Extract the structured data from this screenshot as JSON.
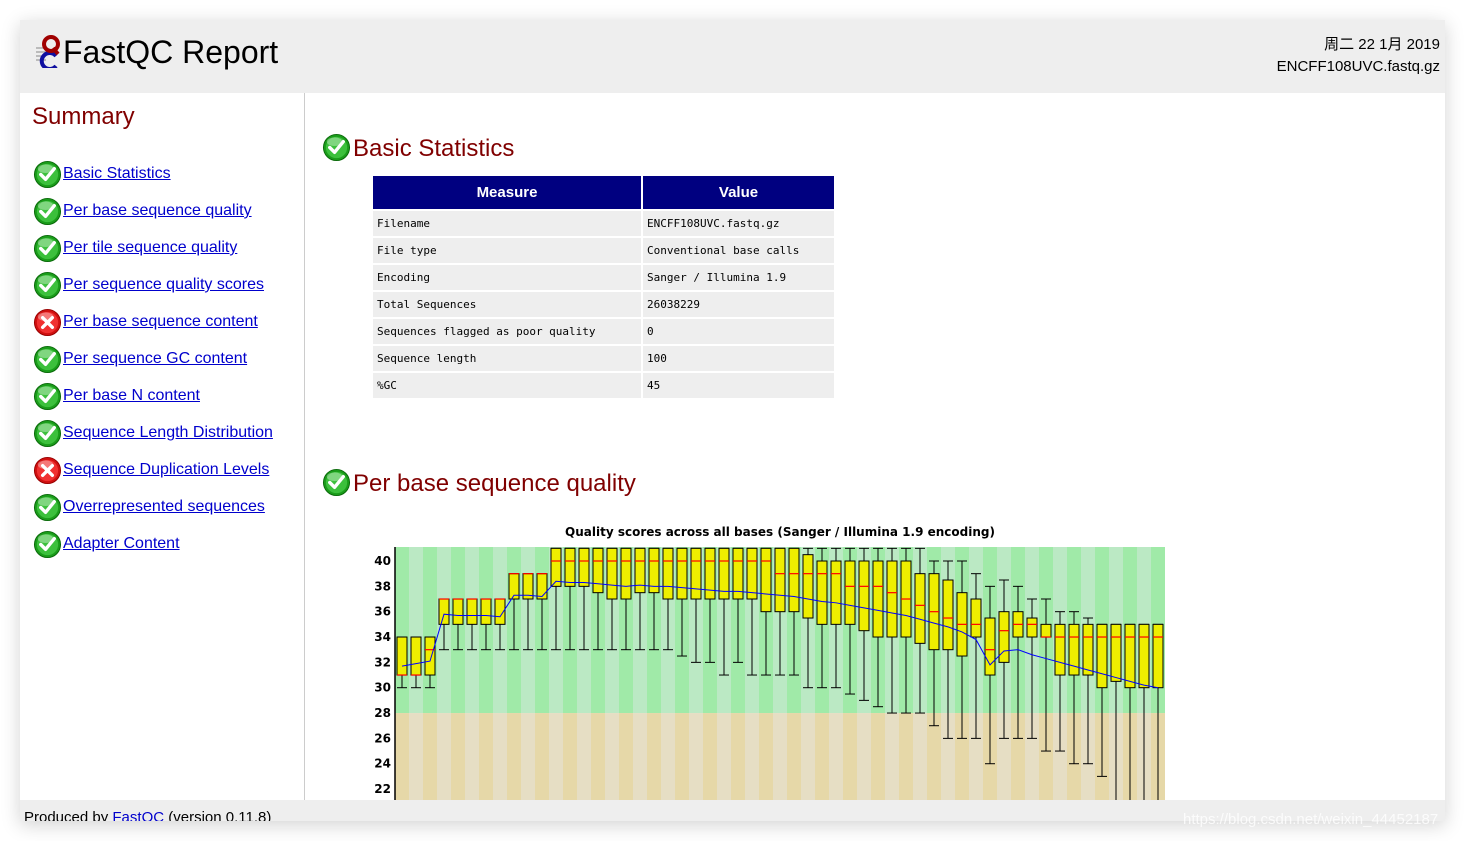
{
  "header": {
    "title": "FastQC Report",
    "date": "周二 22 1月 2019",
    "filename": "ENCFF108UVC.fastq.gz"
  },
  "sidebar": {
    "title": "Summary",
    "items": [
      {
        "label": "Basic Statistics",
        "status": "pass"
      },
      {
        "label": "Per base sequence quality",
        "status": "pass"
      },
      {
        "label": "Per tile sequence quality",
        "status": "pass"
      },
      {
        "label": "Per sequence quality scores",
        "status": "pass"
      },
      {
        "label": "Per base sequence content",
        "status": "fail"
      },
      {
        "label": "Per sequence GC content",
        "status": "pass"
      },
      {
        "label": "Per base N content",
        "status": "pass"
      },
      {
        "label": "Sequence Length Distribution",
        "status": "pass"
      },
      {
        "label": "Sequence Duplication Levels",
        "status": "fail"
      },
      {
        "label": "Overrepresented sequences",
        "status": "pass"
      },
      {
        "label": "Adapter Content",
        "status": "pass"
      }
    ]
  },
  "basic_stats": {
    "title": "Basic Statistics",
    "status": "pass",
    "headers": [
      "Measure",
      "Value"
    ],
    "rows": [
      [
        "Filename",
        "ENCFF108UVC.fastq.gz"
      ],
      [
        "File type",
        "Conventional base calls"
      ],
      [
        "Encoding",
        "Sanger / Illumina 1.9"
      ],
      [
        "Total Sequences",
        "26038229"
      ],
      [
        "Sequences flagged as poor quality",
        "0"
      ],
      [
        "Sequence length",
        "100"
      ],
      [
        "%GC",
        "45"
      ]
    ]
  },
  "per_base_quality": {
    "title": "Per base sequence quality",
    "status": "pass"
  },
  "chart_data": {
    "type": "boxplot",
    "title": "Quality scores across all bases (Sanger / Illumina 1.9 encoding)",
    "xlabel": "",
    "ylabel": "",
    "ylim": [
      21,
      41
    ],
    "yticks": [
      "22",
      "24",
      "26",
      "28",
      "30",
      "32",
      "34",
      "36",
      "38",
      "40"
    ],
    "zones": [
      {
        "from": 28,
        "to": 41,
        "color": "#a0eaa8"
      },
      {
        "from": 0,
        "to": 28,
        "color": "#e6d8a8"
      }
    ],
    "columns": [
      "low",
      "q1",
      "median",
      "q3",
      "high",
      "mean"
    ],
    "boxes": [
      [
        30,
        31,
        31,
        34,
        34,
        31.7
      ],
      [
        30,
        31,
        31,
        34,
        34,
        31.9
      ],
      [
        30,
        31,
        33,
        34,
        34,
        32.1
      ],
      [
        33,
        35,
        37,
        37,
        37,
        35.8
      ],
      [
        33,
        35,
        37,
        37,
        37,
        35.7
      ],
      [
        33,
        35,
        37,
        37,
        37,
        35.7
      ],
      [
        33,
        35,
        37,
        37,
        37,
        35.7
      ],
      [
        33,
        35,
        37,
        37,
        37,
        35.6
      ],
      [
        33,
        37,
        39,
        39,
        39,
        37.3
      ],
      [
        33,
        37,
        39,
        39,
        39,
        37.3
      ],
      [
        33,
        37,
        39,
        39,
        39,
        37.2
      ],
      [
        33,
        38,
        40,
        41,
        41,
        38.4
      ],
      [
        33,
        38,
        40,
        41,
        41,
        38.3
      ],
      [
        33,
        38,
        40,
        41,
        41,
        38.3
      ],
      [
        33,
        37.5,
        40,
        41,
        41,
        38.2
      ],
      [
        33,
        37,
        40,
        41,
        41,
        38.1
      ],
      [
        33,
        37,
        40,
        41,
        41,
        38.0
      ],
      [
        33,
        37.5,
        40,
        41,
        41,
        38.1
      ],
      [
        33,
        37.5,
        40,
        41,
        41,
        38.0
      ],
      [
        33,
        37,
        40,
        41,
        41,
        38.0
      ],
      [
        32.5,
        37,
        40,
        41,
        41,
        37.9
      ],
      [
        32,
        37,
        40,
        41,
        41,
        37.8
      ],
      [
        32,
        37,
        40,
        41,
        41,
        37.7
      ],
      [
        31,
        37,
        40,
        41,
        41,
        37.6
      ],
      [
        32,
        37,
        40,
        41,
        41,
        37.6
      ],
      [
        31,
        37,
        40,
        41,
        41,
        37.5
      ],
      [
        31,
        36,
        40,
        41,
        41,
        37.4
      ],
      [
        31,
        36,
        39,
        41,
        41,
        37.3
      ],
      [
        31,
        36,
        39,
        41,
        41,
        37.2
      ],
      [
        30,
        35.5,
        39,
        40.5,
        41,
        37.0
      ],
      [
        30,
        35,
        39,
        40,
        41,
        36.8
      ],
      [
        30,
        35,
        39,
        40,
        41,
        36.7
      ],
      [
        29.5,
        35,
        38,
        40,
        41,
        36.5
      ],
      [
        29,
        34.5,
        38,
        40,
        41,
        36.3
      ],
      [
        28.5,
        34,
        38,
        40,
        41,
        36.1
      ],
      [
        28,
        34,
        37.5,
        40,
        41,
        35.9
      ],
      [
        28,
        34,
        37,
        40,
        41,
        35.7
      ],
      [
        28,
        33.5,
        36.5,
        39,
        41,
        35.4
      ],
      [
        27,
        33,
        36,
        39,
        40,
        35.1
      ],
      [
        26,
        33,
        35.5,
        38.5,
        40,
        34.8
      ],
      [
        26,
        32.5,
        35,
        37.5,
        40,
        34.4
      ],
      [
        26,
        34,
        35,
        37,
        39,
        33.8
      ],
      [
        24,
        31,
        33,
        35.5,
        38,
        31.8
      ],
      [
        26,
        32,
        34.5,
        36,
        38.5,
        32.9
      ],
      [
        26,
        34,
        35,
        36,
        38,
        33.0
      ],
      [
        26,
        34,
        35,
        35.5,
        37,
        32.6
      ],
      [
        25,
        34,
        34,
        35,
        37,
        32.3
      ],
      [
        25,
        31,
        34,
        35,
        36,
        32.0
      ],
      [
        24,
        31,
        34,
        35,
        36,
        31.7
      ],
      [
        24,
        31,
        34,
        35,
        35.5,
        31.4
      ],
      [
        23,
        30,
        34,
        35,
        35,
        31.1
      ],
      [
        20,
        30.5,
        34,
        35,
        35,
        30.8
      ],
      [
        20,
        30,
        34,
        35,
        35,
        30.5
      ],
      [
        20,
        30,
        34,
        35,
        35,
        30.2
      ],
      [
        20,
        30,
        34,
        35,
        35,
        30.0
      ]
    ],
    "colors": {
      "box": "#eeee00",
      "median": "#ff0000",
      "mean": "#0000ff",
      "good_a": "#a0eaa8",
      "good_b": "#bbe9c4",
      "warn_a": "#e6d8a8",
      "warn_b": "#e6dec4"
    }
  },
  "footer": {
    "prefix": "Produced by ",
    "link": "FastQC",
    "suffix": " (version 0.11.8)"
  },
  "watermark": "https://blog.csdn.net/weixin_44452187"
}
